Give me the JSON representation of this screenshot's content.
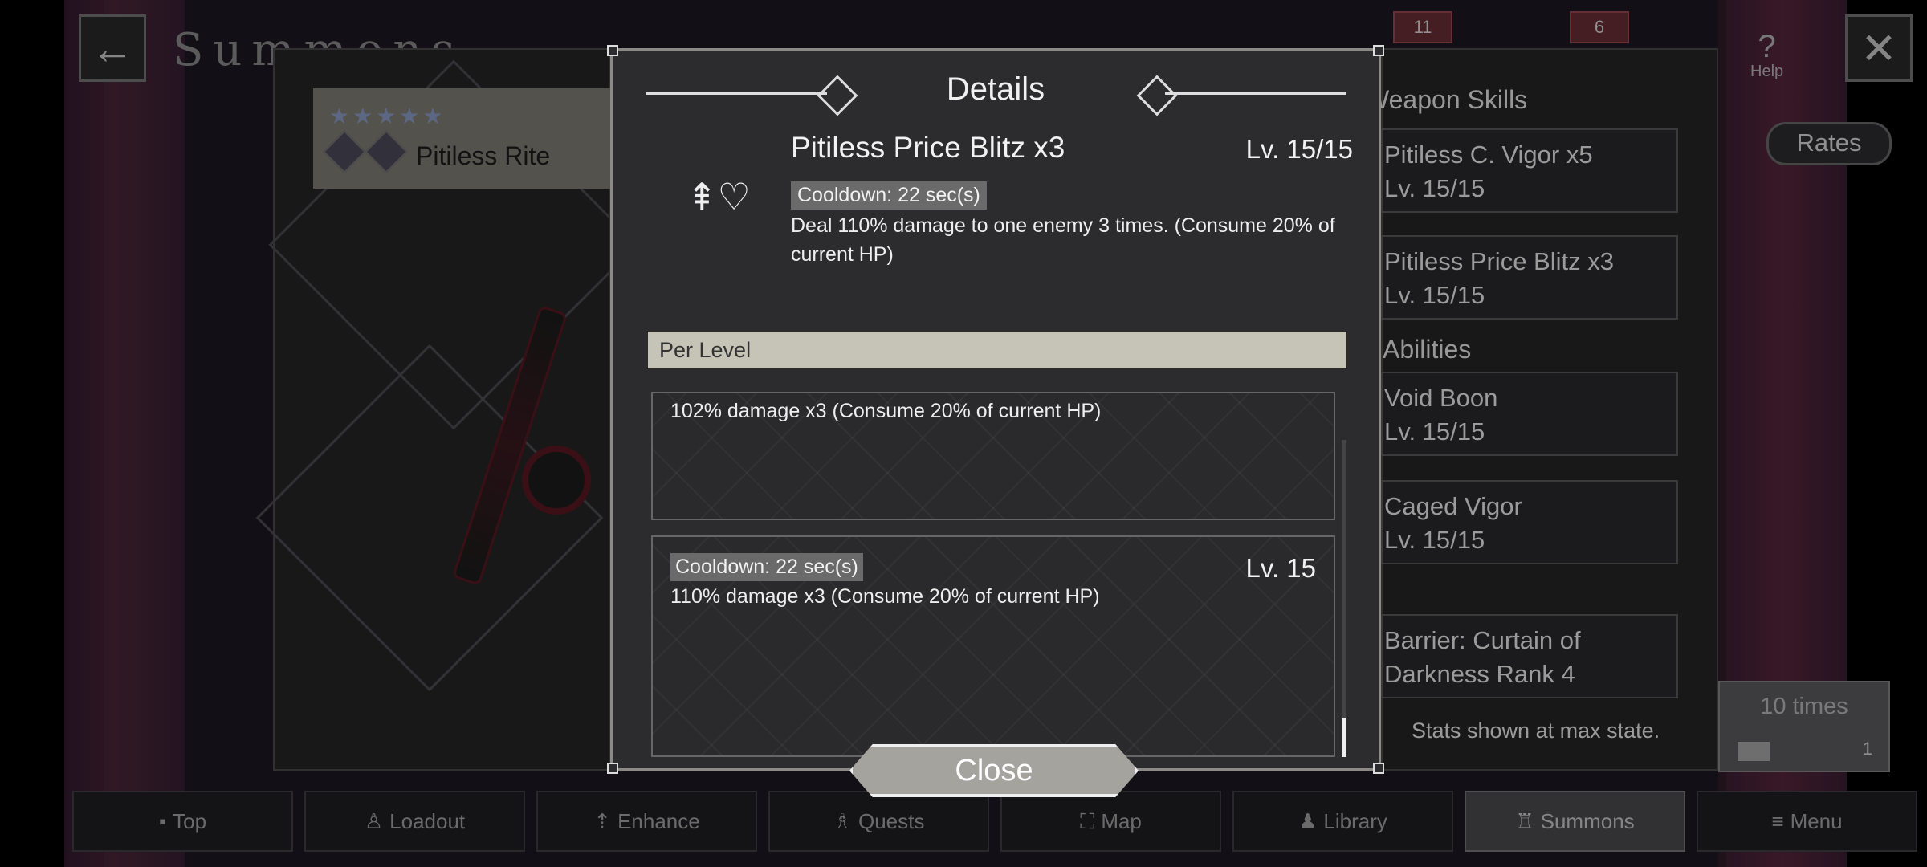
{
  "screen": {
    "title": "Summons"
  },
  "top_bar": {
    "help_label": "Help",
    "badge_a": "11",
    "badge_b": "6"
  },
  "weapon": {
    "stars": "★★★★★",
    "rite_name": "Pitiless Rite"
  },
  "right_panel": {
    "weapon_skills_heading": "Weapon Skills",
    "skills": [
      {
        "name": "Pitiless C. Vigor x5",
        "level": "Lv. 15/15"
      },
      {
        "name": "Pitiless Price Blitz x3",
        "level": "Lv. 15/15"
      }
    ],
    "abilities_heading": "Abilities",
    "abilities": [
      {
        "name": "Void Boon",
        "level": "Lv. 15/15"
      },
      {
        "name": "Caged Vigor",
        "level": "Lv. 15/15"
      },
      {
        "name": "Barrier: Curtain of",
        "level": "Darkness Rank 4"
      }
    ],
    "stats_note": "Stats shown at max state.",
    "rates_label": "Rates",
    "ten_times_label": "10 times",
    "ticket_count": "1"
  },
  "details_modal": {
    "title": "Details",
    "skill_name": "Pitiless Price Blitz x3",
    "skill_level": "Lv. 15/15",
    "cooldown": "Cooldown: 22 sec(s)",
    "description": "Deal 110% damage to one enemy 3 times. (Consume 20% of current HP)",
    "per_level_label": "Per Level",
    "levels": [
      {
        "text": "102% damage x3 (Consume 20% of current HP)"
      },
      {
        "cooldown": "Cooldown: 22 sec(s)",
        "level": "Lv. 15",
        "text": "110% damage x3 (Consume 20% of current HP)"
      }
    ],
    "close_label": "Close"
  },
  "bottom_nav": [
    {
      "label": "Top"
    },
    {
      "label": "Loadout"
    },
    {
      "label": "Enhance"
    },
    {
      "label": "Quests"
    },
    {
      "label": "Map"
    },
    {
      "label": "Library"
    },
    {
      "label": "Summons",
      "active": true
    },
    {
      "label": "Menu"
    }
  ]
}
